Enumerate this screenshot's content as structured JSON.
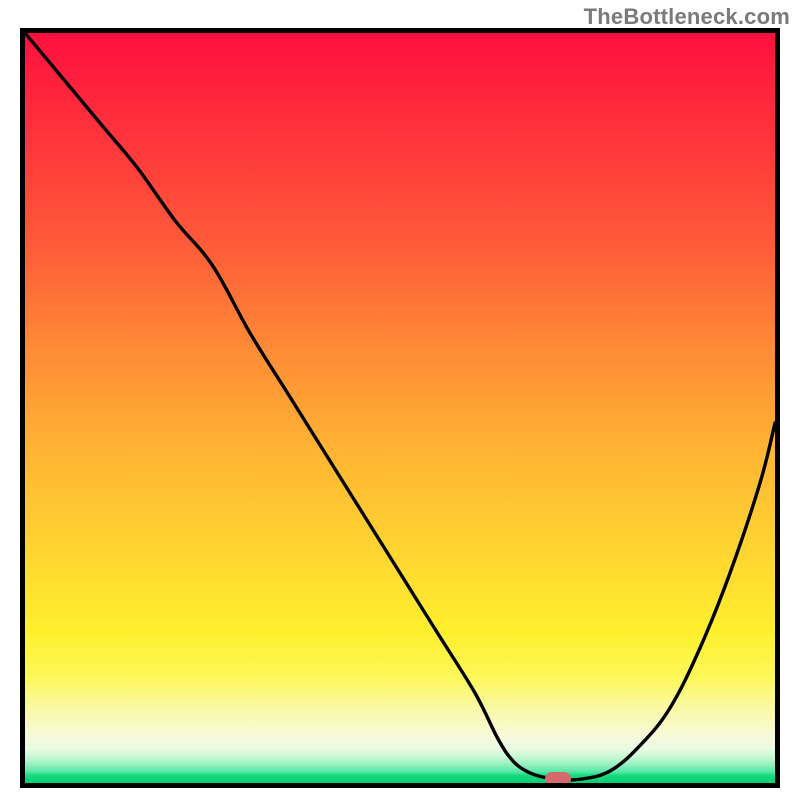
{
  "watermark": "TheBottleneck.com",
  "colors": {
    "frame": "#000000",
    "curve": "#000000",
    "marker": "#d46a6d",
    "gradient_top": "#ff0f3e",
    "gradient_bottom": "#03d06f"
  },
  "chart_data": {
    "type": "line",
    "title": "",
    "xlabel": "",
    "ylabel": "",
    "xlim": [
      0,
      100
    ],
    "ylim": [
      0,
      100
    ],
    "series": [
      {
        "name": "curve",
        "x": [
          0,
          5,
          10,
          15,
          20,
          25,
          30,
          35,
          40,
          45,
          50,
          55,
          60,
          63,
          65,
          67,
          69,
          71,
          74,
          78,
          82,
          86,
          90,
          94,
          98,
          100
        ],
        "y": [
          100,
          94,
          88,
          82,
          75,
          69,
          60,
          52,
          44,
          36,
          28,
          20,
          12,
          6,
          3,
          1.5,
          0.8,
          0.5,
          0.5,
          1.6,
          5,
          10,
          18,
          28,
          40,
          48
        ]
      }
    ],
    "marker": {
      "x": 71,
      "y": 0.5
    },
    "background_gradient_stops": [
      {
        "pos": 0.0,
        "color": "#ff0f3e"
      },
      {
        "pos": 0.28,
        "color": "#ff5a39"
      },
      {
        "pos": 0.55,
        "color": "#ffb233"
      },
      {
        "pos": 0.8,
        "color": "#fff02e"
      },
      {
        "pos": 0.94,
        "color": "#f6fadd"
      },
      {
        "pos": 1.0,
        "color": "#03d06f"
      }
    ]
  }
}
